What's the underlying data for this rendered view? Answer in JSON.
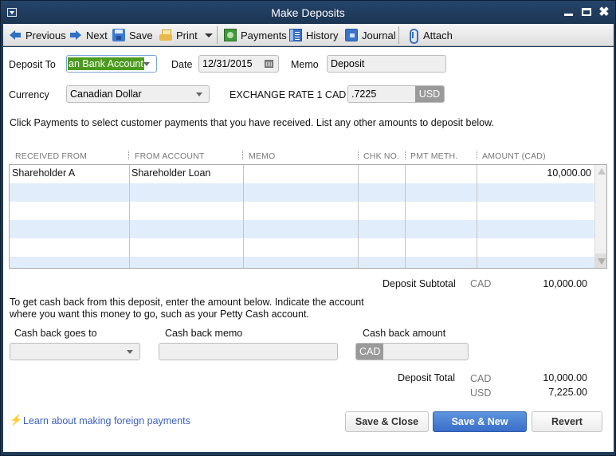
{
  "window": {
    "title": "Make Deposits",
    "controls": [
      "minimize-icon",
      "maximize-icon",
      "close-icon"
    ]
  },
  "toolbar": {
    "items": [
      {
        "label": "Previous",
        "icon": "arrow-left-icon"
      },
      {
        "label": "Next",
        "icon": "arrow-right-icon"
      },
      {
        "label": "Save",
        "icon": "floppy-disk-icon"
      },
      {
        "label": "Print",
        "icon": "printer-icon"
      },
      {
        "label": "Payments",
        "icon": "money-icon"
      },
      {
        "label": "History",
        "icon": "history-icon"
      },
      {
        "label": "Journal",
        "icon": "journal-icon"
      },
      {
        "label": "Attach",
        "icon": "paperclip-icon"
      }
    ]
  },
  "header": {
    "deposit_to_label": "Deposit To",
    "deposit_to_value": "an Bank Account",
    "date_label": "Date",
    "date_value": "12/31/2015",
    "memo_label": "Memo",
    "memo_value": "Deposit",
    "currency_label": "Currency",
    "currency_value": "Canadian Dollar",
    "exchange_label": "EXCHANGE RATE 1 CAD =",
    "exchange_value": ".7225",
    "exchange_currency": "USD"
  },
  "instruction": "Click Payments to select customer payments that you have received. List any other amounts to deposit below.",
  "grid": {
    "columns": [
      "RECEIVED FROM",
      "FROM ACCOUNT",
      "MEMO",
      "CHK NO.",
      "PMT METH.",
      "AMOUNT (CAD)"
    ],
    "rows": [
      {
        "received_from": "Shareholder A",
        "from_account": "Shareholder Loan",
        "memo": "",
        "chk_no": "",
        "pmt_meth": "",
        "amount": "10,000.00"
      },
      {
        "received_from": "",
        "from_account": "",
        "memo": "",
        "chk_no": "",
        "pmt_meth": "",
        "amount": ""
      },
      {
        "received_from": "",
        "from_account": "",
        "memo": "",
        "chk_no": "",
        "pmt_meth": "",
        "amount": ""
      },
      {
        "received_from": "",
        "from_account": "",
        "memo": "",
        "chk_no": "",
        "pmt_meth": "",
        "amount": ""
      },
      {
        "received_from": "",
        "from_account": "",
        "memo": "",
        "chk_no": "",
        "pmt_meth": "",
        "amount": ""
      },
      {
        "received_from": "",
        "from_account": "",
        "memo": "",
        "chk_no": "",
        "pmt_meth": "",
        "amount": ""
      }
    ]
  },
  "subtotal": {
    "label": "Deposit Subtotal",
    "currency": "CAD",
    "amount": "10,000.00"
  },
  "cashback": {
    "text_line1": "To get cash back from this deposit, enter the amount below.  Indicate the account",
    "text_line2": "where you want this money to go, such as your Petty Cash account.",
    "goes_to_label": "Cash back goes to",
    "goes_to_value": "",
    "memo_label": "Cash back memo",
    "memo_value": "",
    "amount_label": "Cash back amount",
    "amount_currency": "CAD",
    "amount_value": ""
  },
  "total": {
    "label": "Deposit Total",
    "cad_currency": "CAD",
    "cad_amount": "10,000.00",
    "usd_currency": "USD",
    "usd_amount": "7,225.00"
  },
  "footer": {
    "learn_link": "Learn about making foreign payments",
    "save_close": "Save & Close",
    "save_new": "Save & New",
    "revert": "Revert"
  },
  "colors": {
    "title_bar": "#1f3a57",
    "row_alt": "#e2edfc",
    "primary_button": "#3a6ec9",
    "selection": "#4b9b1e",
    "link": "#3a5ec0"
  }
}
